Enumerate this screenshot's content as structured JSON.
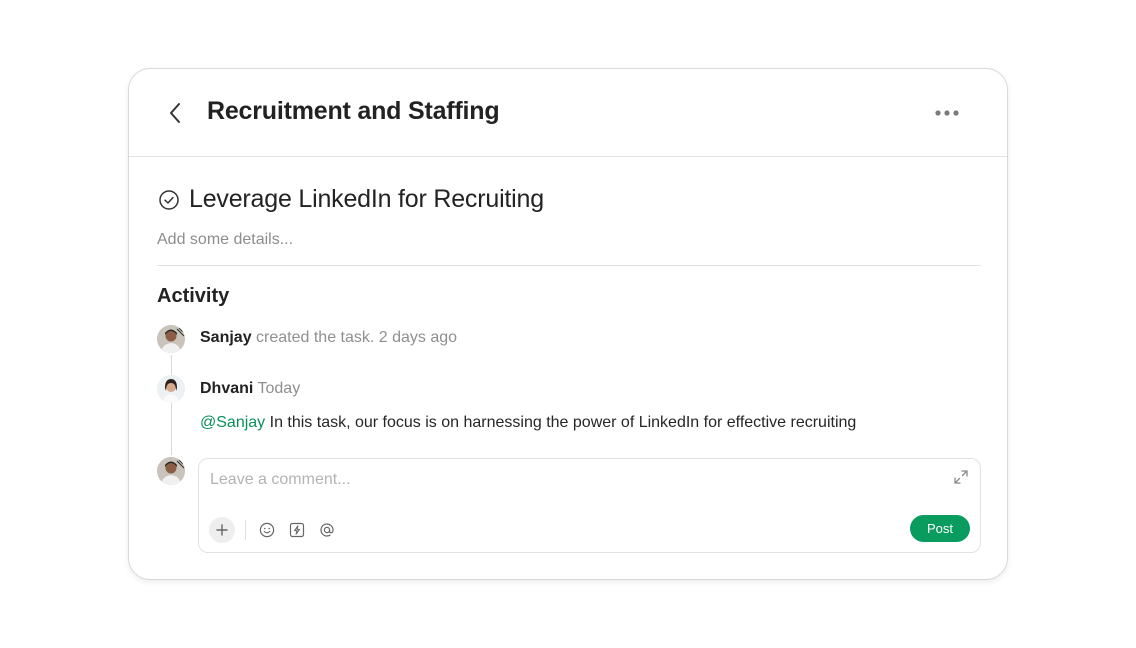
{
  "header": {
    "title": "Recruitment and Staffing"
  },
  "task": {
    "title": "Leverage LinkedIn for Recruiting",
    "details_placeholder": "Add some details..."
  },
  "activity": {
    "heading": "Activity",
    "items": [
      {
        "user": "Sanjay",
        "text": "created the task. 2 days ago"
      },
      {
        "user": "Dhvani",
        "text": "Today",
        "mention": "@Sanjay",
        "comment": " In this task, our focus is on harnessing the power of LinkedIn for effective recruiting"
      }
    ]
  },
  "composer": {
    "placeholder": "Leave a comment...",
    "post_label": "Post",
    "tools": [
      "plus-icon",
      "emoji-icon",
      "lightning-icon",
      "at-icon"
    ]
  },
  "colors": {
    "accent": "#0a9b5f",
    "mention": "#0b8f59"
  }
}
